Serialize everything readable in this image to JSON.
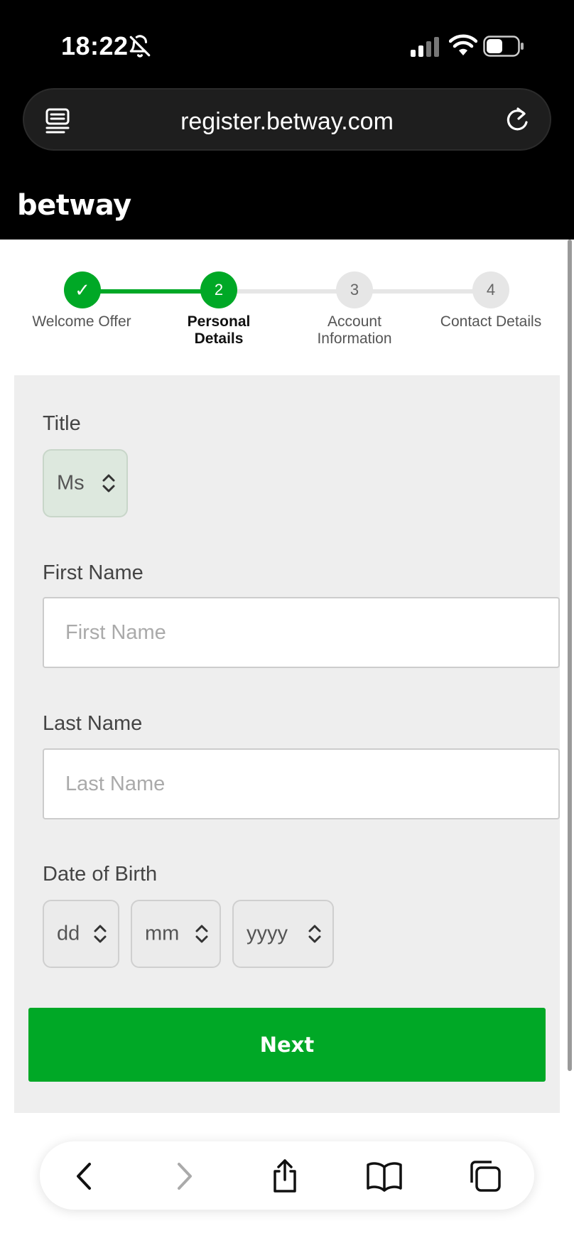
{
  "status_bar": {
    "time": "18:22"
  },
  "browser": {
    "url": "register.betway.com"
  },
  "site": {
    "logo": "betway"
  },
  "stepper": {
    "steps": [
      {
        "number": "✓",
        "label_line1": "Welcome Offer",
        "label_line2": "",
        "state": "done"
      },
      {
        "number": "2",
        "label_line1": "Personal",
        "label_line2": "Details",
        "state": "active"
      },
      {
        "number": "3",
        "label_line1": "Account",
        "label_line2": "Information",
        "state": "pending"
      },
      {
        "number": "4",
        "label_line1": "Contact Details",
        "label_line2": "",
        "state": "pending"
      }
    ]
  },
  "form": {
    "title_label": "Title",
    "title_value": "Ms",
    "first_name_label": "First Name",
    "first_name_placeholder": "First Name",
    "last_name_label": "Last Name",
    "last_name_placeholder": "Last Name",
    "dob_label": "Date of Birth",
    "dob_day": "dd",
    "dob_month": "mm",
    "dob_year": "yyyy",
    "next_label": "Next"
  },
  "colors": {
    "brand_green": "#00a826",
    "header_bg": "#000000",
    "card_bg": "#eeeeee",
    "step_pending": "#e6e6e6"
  },
  "icons": {
    "status": [
      "bell-slash-icon",
      "signal-icon",
      "wifi-icon",
      "battery-icon"
    ],
    "urlbar": [
      "reader-icon",
      "reload-icon"
    ],
    "toolbar": [
      "back-icon",
      "forward-icon",
      "share-icon",
      "bookmarks-icon",
      "tabs-icon"
    ]
  }
}
